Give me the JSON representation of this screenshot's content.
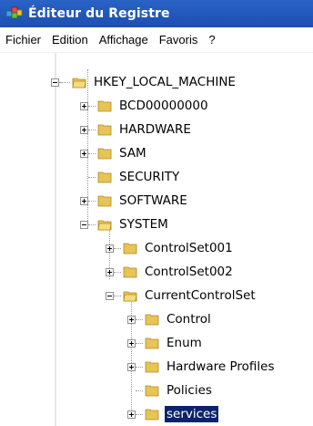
{
  "window": {
    "title": "Éditeur du Registre"
  },
  "menu": [
    "Fichier",
    "Edition",
    "Affichage",
    "Favoris",
    "?"
  ],
  "tree": {
    "root": "HKEY_LOCAL_MACHINE",
    "hklm_children": [
      "BCD00000000",
      "HARDWARE",
      "SAM",
      "SECURITY",
      "SOFTWARE",
      "SYSTEM"
    ],
    "system_children": [
      "ControlSet001",
      "ControlSet002",
      "CurrentControlSet"
    ],
    "ccs_children": [
      "Control",
      "Enum",
      "Hardware Profiles",
      "Policies",
      "services"
    ],
    "selected": "services"
  }
}
